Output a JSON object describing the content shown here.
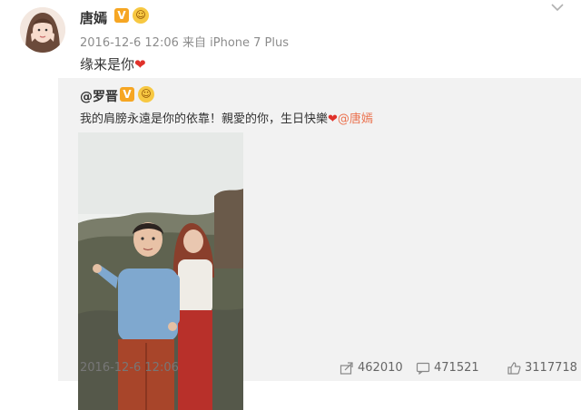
{
  "post": {
    "author": "唐嫣",
    "verified_badge": "V",
    "medal_icon": "fan-medal-icon",
    "meta": "2016-12-6 12:06 来自 iPhone 7 Plus",
    "text": "缘来是你"
  },
  "retweet": {
    "author": "@罗晋",
    "verified_badge": "V",
    "text": "我的肩膀永遠是你的依靠！親愛的你，生日快樂",
    "mention": "@唐嫣",
    "time": "2016-12-6 12:06",
    "share_count": "462010",
    "comment_count": "471521",
    "like_count": "3117718"
  },
  "icons": {
    "heart": "❤",
    "share": "share-icon",
    "comment": "comment-icon",
    "like": "like-icon",
    "chevron": "chevron-down-icon"
  },
  "colors": {
    "accent": "#eb7350",
    "heart": "#e0312a",
    "verified": "#f6a623",
    "retweet_bg": "#f2f2f2"
  }
}
